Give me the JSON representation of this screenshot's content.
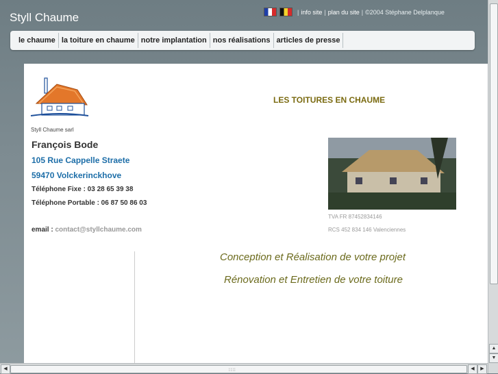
{
  "header": {
    "site_title": "Styll Chaume",
    "links": {
      "info": "info site",
      "plan": "plan du site"
    },
    "copyright": "©2004 Stéphane Delplanque",
    "flags": [
      "flag-fr-icon",
      "flag-be-icon"
    ]
  },
  "menu": {
    "items": [
      {
        "label": "le chaume"
      },
      {
        "label": "la toiture en chaume"
      },
      {
        "label": "notre implantation"
      },
      {
        "label": "nos réalisations"
      },
      {
        "label": "articles de presse"
      }
    ]
  },
  "main": {
    "heading": "LES TOITURES EN CHAUME",
    "company": "Styll Chaume sarl",
    "person": "François Bode",
    "address_line1": "105 Rue Cappelle Straete",
    "address_line2": "59470 Volckerinckhove",
    "phone_fixed": "Téléphone Fixe : 03 28 65 39 38",
    "phone_mobile": "Téléphone Portable : 06 87 50 86 03",
    "email_label": "email : ",
    "email_value": "contact@styllchaume.com",
    "tva": "TVA FR 87452834146",
    "rcs": "RCS 452 834 146 Valenciennes",
    "slogan1": "Conception et Réalisation de votre projet",
    "slogan2": "Rénovation et Entretien de votre toiture"
  },
  "colors": {
    "accent_gold": "#7a6a10",
    "link_blue": "#1d6ea8",
    "slogan": "#6b6a1c"
  }
}
